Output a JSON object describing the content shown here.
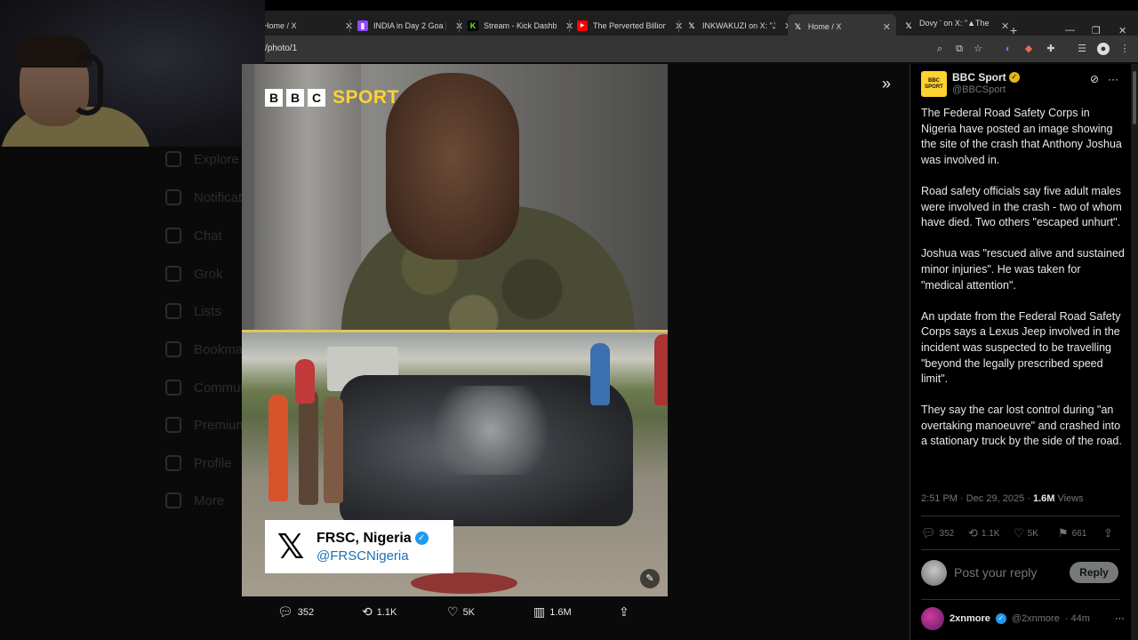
{
  "browser": {
    "tabs": [
      {
        "title": "Home / X",
        "favicon": "x-icon"
      },
      {
        "title": "INDIA in Day 2 Goa |",
        "favicon": "twitch-icon"
      },
      {
        "title": "Stream - Kick Dashbo",
        "favicon": "kick-icon"
      },
      {
        "title": "The Perverted Billion",
        "favicon": "youtube-icon"
      },
      {
        "title": "INKWAKUZI on X: \"Ju",
        "favicon": "x-icon"
      },
      {
        "title": "Home / X",
        "favicon": "x-icon",
        "active": true
      },
      {
        "title": "Dovy ་ on X: \"▲The",
        "favicon": "x-icon"
      }
    ],
    "url": "/photo/1"
  },
  "media": {
    "bbc_letters": [
      "B",
      "B",
      "C"
    ],
    "bbc_sport": "SPORT",
    "frsc_name": "FRSC, Nigeria",
    "frsc_handle": "@FRSCNigeria"
  },
  "media_actions": {
    "replies": "352",
    "reposts": "1.1K",
    "likes": "5K",
    "views": "1.6M"
  },
  "tweet": {
    "author_name": "BBC Sport",
    "author_handle": "@BBCSport",
    "avatar_lines": [
      "BBC",
      "SPORT"
    ],
    "paragraphs": [
      "The Federal Road Safety Corps in Nigeria have posted an image showing the site of the crash that Anthony Joshua was involved in.",
      "Road safety officials say five adult males were involved in the crash - two of whom have died. Two others \"escaped unhurt\".",
      "Joshua was \"rescued alive and sustained minor injuries\". He was taken for \"medical attention\".",
      "An update from the Federal Road Safety Corps says a Lexus Jeep involved in the incident was suspected to be travelling \"beyond the legally prescribed speed limit\".",
      "They say the car lost control during \"an overtaking manoeuvre\" and crashed into a stationary truck by the side of the road."
    ],
    "time": "2:51 PM · Dec 29, 2025 ·",
    "views_count": "1.6M",
    "views_label": "Views",
    "replies": "352",
    "reposts": "1.1K",
    "likes": "5K",
    "bookmarks": "661"
  },
  "reply_box": {
    "placeholder": "Post your reply",
    "button": "Reply"
  },
  "next_reply": {
    "name": "2xnmore",
    "handle": "@2xnmore",
    "time": "· 44m"
  },
  "background_nav": [
    "Explore",
    "Notifications",
    "Chat",
    "Grok",
    "Lists",
    "Bookmarks",
    "Communities",
    "Premium",
    "Profile",
    "More"
  ],
  "colors": {
    "bbc_yellow": "#ffd230",
    "x_blue": "#1d9bf0",
    "gold_badge": "#e2b719"
  }
}
